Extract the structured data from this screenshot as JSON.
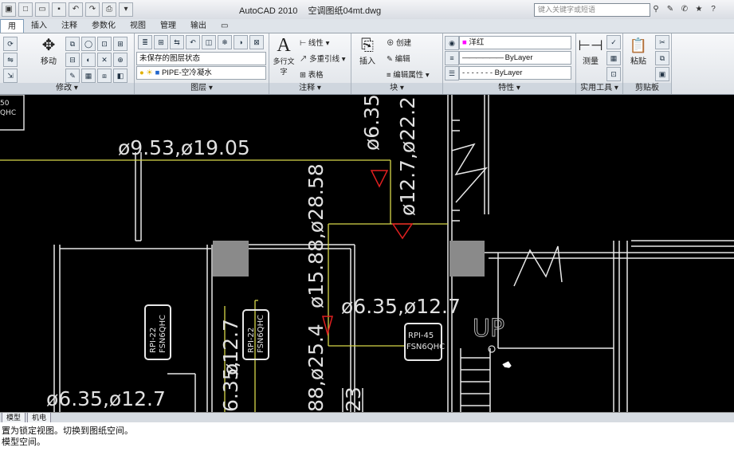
{
  "title_bar": {
    "app_name": "AutoCAD 2010",
    "file_name": "空调图纸04mt.dwg",
    "search_placeholder": "键入关键字或短语"
  },
  "ribbon_tabs": [
    "用",
    "插入",
    "注释",
    "参数化",
    "视图",
    "管理",
    "输出"
  ],
  "ribbon": {
    "modify": {
      "label": "修改",
      "move": "移动"
    },
    "layers": {
      "label": "图层",
      "layer_state": "未保存的图层状态",
      "current_layer": "PIPE-空冷凝水"
    },
    "annotation": {
      "label": "注释",
      "mtext": "多行文字",
      "linear": "线性",
      "mleader": "多重引线",
      "table": "表格"
    },
    "block": {
      "label": "块",
      "insert": "插入",
      "create": "创建",
      "edit": "编辑",
      "edit_attr": "编辑属性"
    },
    "properties": {
      "label": "特性",
      "color": "洋红",
      "linetype": "ByLayer",
      "lineweight": "ByLayer"
    },
    "utilities": {
      "label": "实用工具",
      "measure": "测量"
    },
    "clipboard": {
      "label": "剪贴板",
      "paste": "粘贴"
    }
  },
  "canvas": {
    "corner_tag_top": "50",
    "corner_tag_bottom": "QHC",
    "dims": {
      "d1": "ø9.53,ø19.05",
      "d2": "ø6.35",
      "d3": "ø12.7,ø22.2",
      "d4": "ø15.88,ø28.58",
      "d5": "ø6.35,ø12.7",
      "d6": "88,ø25.4",
      "d7": "ø12.7",
      "d8": "6.35,",
      "d9": "ø6.35,ø12.7",
      "d10": "23",
      "up": "UP"
    },
    "units": [
      {
        "model": "RPI-22",
        "code": "FSN6QHC"
      },
      {
        "model": "RPI-22",
        "code": "FSN6QHC"
      },
      {
        "model": "RPI-45",
        "code": "FSN6QHC"
      }
    ]
  },
  "layout_tabs": {
    "model": "模型",
    "layout": "机电"
  },
  "command_lines": [
    "置为锁定视图。切换到图纸空间。",
    "模型空间。"
  ]
}
